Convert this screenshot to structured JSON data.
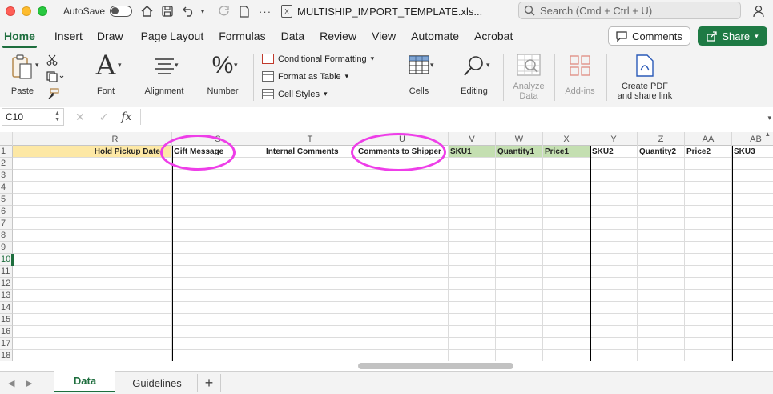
{
  "titlebar": {
    "autosave_label": "AutoSave",
    "filename": "MULTISHIP_IMPORT_TEMPLATE.xls...",
    "search_placeholder": "Search (Cmd + Ctrl + U)"
  },
  "ribbon_tabs": [
    "Home",
    "Insert",
    "Draw",
    "Page Layout",
    "Formulas",
    "Data",
    "Review",
    "View",
    "Automate",
    "Acrobat"
  ],
  "active_tab": "Home",
  "buttons": {
    "comments": "Comments",
    "share": "Share"
  },
  "ribbon": {
    "paste": "Paste",
    "font": "Font",
    "alignment": "Alignment",
    "number": "Number",
    "conditional_formatting": "Conditional Formatting",
    "format_as_table": "Format as Table",
    "cell_styles": "Cell Styles",
    "cells": "Cells",
    "editing": "Editing",
    "analyze_data_1": "Analyze",
    "analyze_data_2": "Data",
    "add_ins": "Add-ins",
    "create_pdf_1": "Create PDF",
    "create_pdf_2": "and share link"
  },
  "formula_bar": {
    "name_box": "C10",
    "fx": "fx",
    "content": ""
  },
  "columns": [
    "R",
    "S",
    "T",
    "U",
    "V",
    "W",
    "X",
    "Y",
    "Z",
    "AA",
    "AB"
  ],
  "header_row": {
    "R": "Hold Pickup Date",
    "S": "Gift Message",
    "T": "Internal Comments",
    "U": "Comments to Shipper",
    "V": "SKU1",
    "W": "Quantity1",
    "X": "Price1",
    "Y": "SKU2",
    "Z": "Quantity2",
    "AA": "Price2",
    "AB": "SKU3"
  },
  "rows": [
    "1",
    "2",
    "3",
    "4",
    "5",
    "6",
    "7",
    "8",
    "9",
    "10",
    "11",
    "12",
    "13",
    "14",
    "15",
    "16",
    "17",
    "18"
  ],
  "active_row": "10",
  "colors": {
    "accent": "#1e6e3e",
    "yellow_header": "#fde8a5",
    "green_header": "#c4dfb1",
    "annotation": "#ee3ee8"
  },
  "sheets": [
    "Data",
    "Guidelines"
  ],
  "active_sheet": "Data",
  "add_sheet": "+"
}
